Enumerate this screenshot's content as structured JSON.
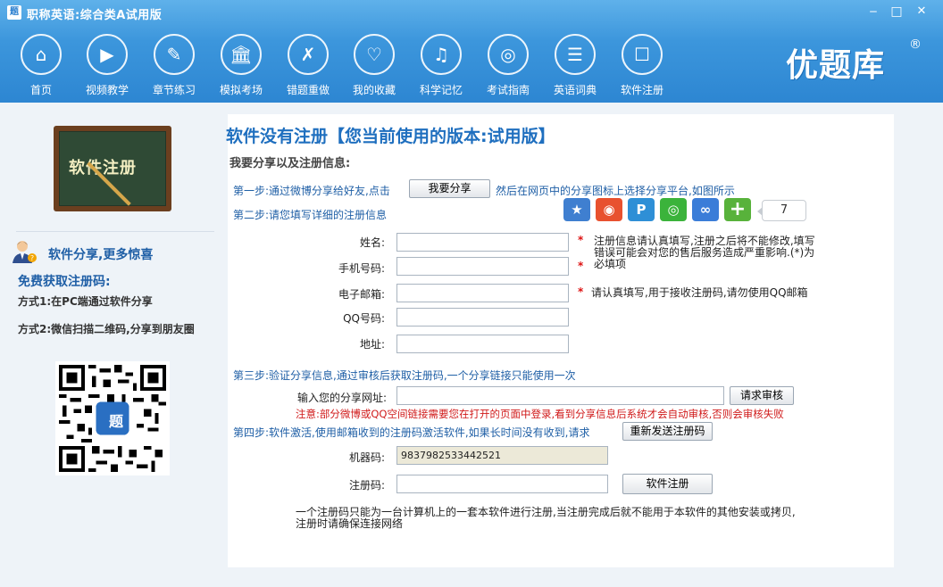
{
  "window": {
    "title": "职称英语:综合类A试用版",
    "app_icon": "题",
    "controls": {
      "minimize": "‒",
      "maximize": "□",
      "close": "✕"
    }
  },
  "nav": {
    "items": [
      {
        "label": "首页",
        "icon": "home-icon",
        "glyph": "⌂"
      },
      {
        "label": "视频教学",
        "icon": "video-icon",
        "glyph": "▶"
      },
      {
        "label": "章节练习",
        "icon": "pencil-icon",
        "glyph": "✎"
      },
      {
        "label": "模拟考场",
        "icon": "building-icon",
        "glyph": "🏛"
      },
      {
        "label": "错题重做",
        "icon": "pen-x-icon",
        "glyph": "✗"
      },
      {
        "label": "我的收藏",
        "icon": "heart-icon",
        "glyph": "♡"
      },
      {
        "label": "科学记忆",
        "icon": "note-icon",
        "glyph": "♫"
      },
      {
        "label": "考试指南",
        "icon": "compass-icon",
        "glyph": "◎"
      },
      {
        "label": "英语词典",
        "icon": "book-icon",
        "glyph": "☰"
      },
      {
        "label": "软件注册",
        "icon": "id-card-icon",
        "glyph": "☐"
      }
    ]
  },
  "brand": {
    "name": "优题库",
    "reg": "®"
  },
  "sidebar": {
    "board_text": "软件注册",
    "share_title": "软件分享,更多惊喜",
    "free_title": "免费获取注册码:",
    "way1": "方式1:在PC端通过软件分享",
    "way2": "方式2:微信扫描二维码,分享到朋友圈",
    "qr_center": "题"
  },
  "main": {
    "title": "软件没有注册【您当前使用的版本:试用版】",
    "subtitle": "我要分享以及注册信息:",
    "step1_prefix": "第一步:通过微博分享给好友,点击",
    "step1_button": "我要分享",
    "step1_suffix": "然后在网页中的分享图标上选择分享平台,如图所示",
    "share_count": "7",
    "step2": "第二步:请您填写详细的注册信息",
    "fields": {
      "name_label": "姓名:",
      "phone_label": "手机号码:",
      "email_label": "电子邮箱:",
      "qq_label": "QQ号码:",
      "address_label": "地址:"
    },
    "star": "*",
    "note_name": "注册信息请认真填写,注册之后将不能修改,填写错误可能会对您的售后服务造成严重影响.(*)为必填项",
    "note_email": "请认真填写,用于接收注册码,请勿使用QQ邮箱",
    "step3": "第三步:验证分享信息,通过审核后获取注册码,一个分享链接只能使用一次",
    "share_url_label": "输入您的分享网址:",
    "review_button": "请求审核",
    "warning": "注意:部分微博或QQ空间链接需要您在打开的页面中登录,看到分享信息后系统才会自动审核,否则会审核失败",
    "step4": "第四步:软件激活,使用邮箱收到的注册码激活软件,如果长时间没有收到,请求",
    "resend_button": "重新发送注册码",
    "machine_label": "机器码:",
    "machine_code": "9837982533442521",
    "regcode_label": "注册码:",
    "register_button": "软件注册",
    "footer_note": "一个注册码只能为一台计算机上的一套本软件进行注册,当注册完成后就不能用于本软件的其他安装或拷贝,注册时请确保连接网络"
  }
}
